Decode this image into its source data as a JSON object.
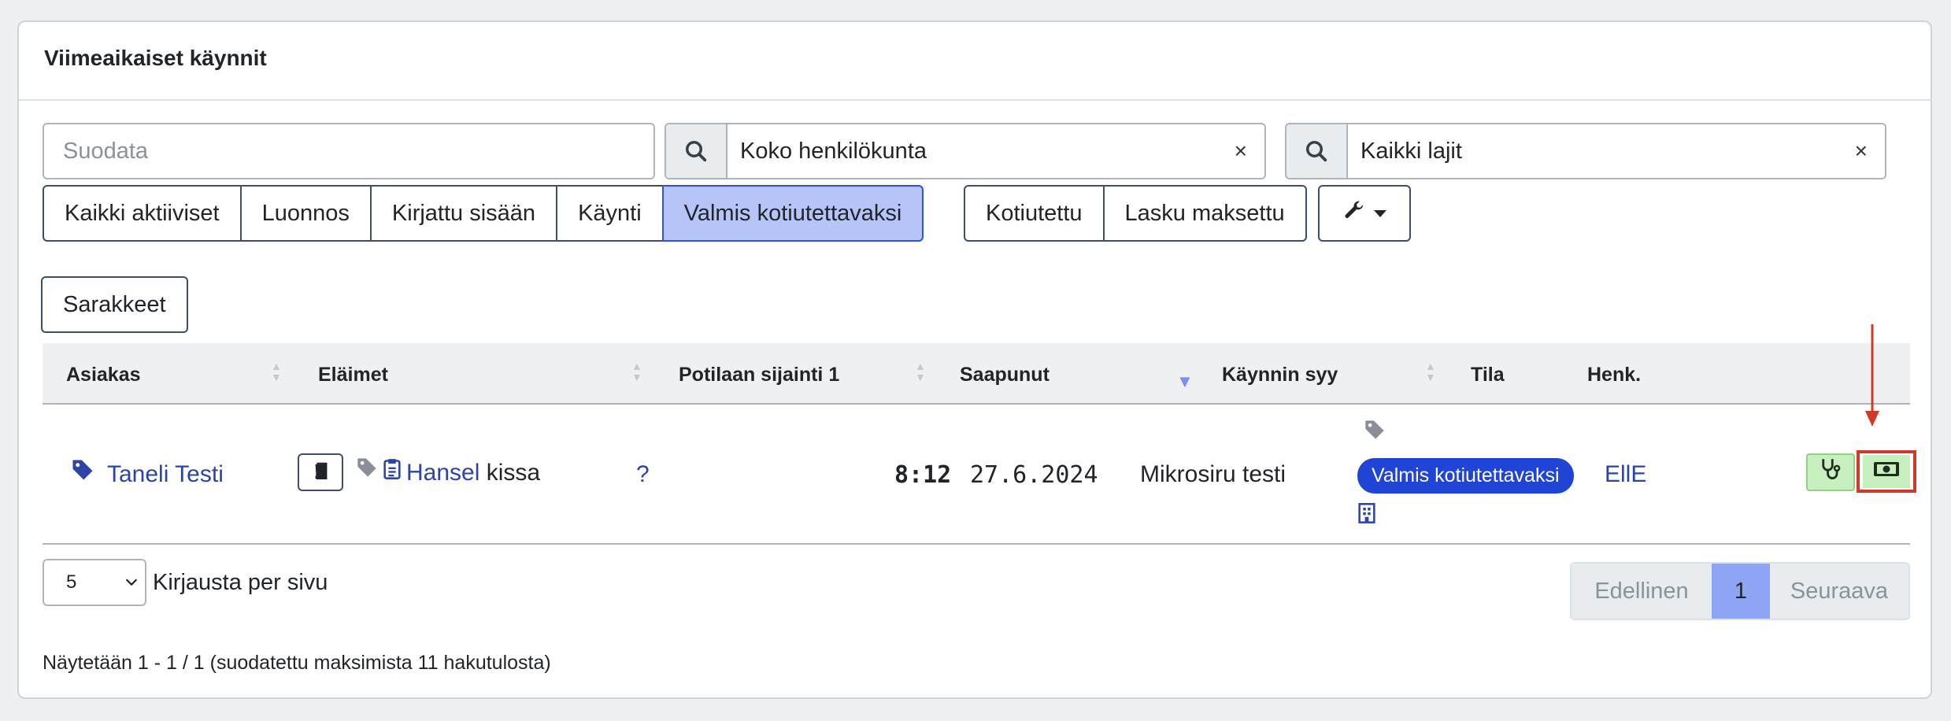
{
  "card": {
    "title": "Viimeaikaiset käynnit"
  },
  "filter": {
    "placeholder": "Suodata"
  },
  "staff_select": {
    "value": "Koko henkilökunta",
    "clear": "×"
  },
  "species_select": {
    "value": "Kaikki lajit",
    "clear": "×"
  },
  "status_tabs": [
    {
      "label": "Kaikki aktiiviset",
      "active": false
    },
    {
      "label": "Luonnos",
      "active": false
    },
    {
      "label": "Kirjattu sisään",
      "active": false
    },
    {
      "label": "Käynti",
      "active": false
    },
    {
      "label": "Valmis kotiutettavaksi",
      "active": true
    }
  ],
  "status_tabs_2": [
    {
      "label": "Kotiutettu"
    },
    {
      "label": "Lasku maksettu"
    }
  ],
  "columns_button": "Sarakkeet",
  "table": {
    "headers": {
      "customer": "Asiakas",
      "animals": "Eläimet",
      "location": "Potilaan sijainti 1",
      "arrived": "Saapunut",
      "reason": "Käynnin syy",
      "status": "Tila",
      "staff": "Henk."
    },
    "row": {
      "customer": "Taneli Testi",
      "animal_name": "Hansel",
      "animal_species": "kissa",
      "location": "?",
      "arrived_time": "8:12",
      "arrived_date": "27.6.2024",
      "reason": "Mikrosiru testi",
      "status": "Valmis kotiutettavaksi",
      "staff": "EllE"
    }
  },
  "pagination": {
    "page_size": "5",
    "per_page_label": "Kirjausta per sivu",
    "previous": "Edellinen",
    "current": "1",
    "next": "Seuraava"
  },
  "summary": "Näytetään 1 - 1 / 1 (suodatettu maksimista 11 hakutulosta)",
  "colors": {
    "link": "#2c44a8",
    "active_tab": "#b6c4f7",
    "badge": "#1f44d6",
    "annotation": "#d23a28"
  }
}
